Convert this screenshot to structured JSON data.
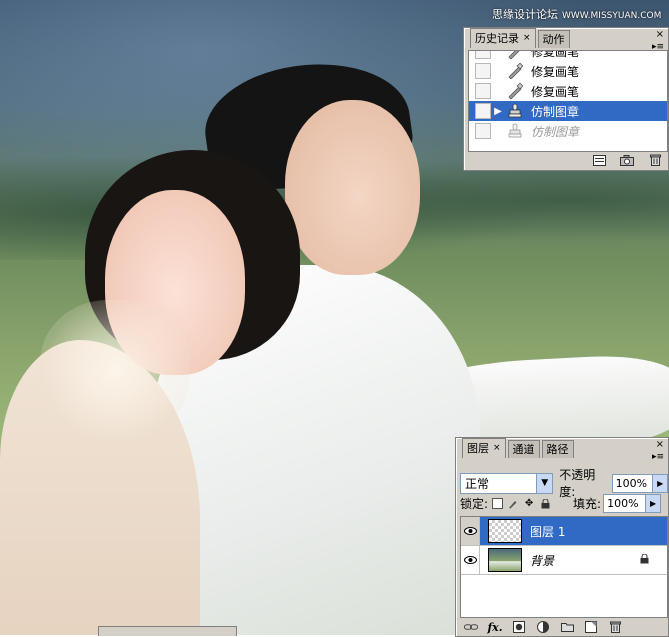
{
  "watermark": {
    "text": "思缘设计论坛",
    "url": "WWW.MISSYUAN.COM"
  },
  "history_panel": {
    "tabs": [
      {
        "label": "历史记录",
        "close": "×"
      },
      {
        "label": "动作"
      }
    ],
    "close_glyph": "×",
    "menu_glyph": "▸≡",
    "items": [
      {
        "label": "修复画笔",
        "icon": "healing-brush-icon"
      },
      {
        "label": "修复画笔",
        "icon": "healing-brush-icon"
      },
      {
        "label": "修复画笔",
        "icon": "healing-brush-icon"
      },
      {
        "label": "仿制图章",
        "icon": "clone-stamp-icon",
        "selected": true,
        "pointer": "▶"
      },
      {
        "label": "仿制图章",
        "icon": "clone-stamp-icon",
        "dimmed": true
      }
    ],
    "footer_icons": [
      "new-document-from-state-icon",
      "snapshot-icon",
      "delete-state-icon"
    ],
    "accent_color": "#316ac5"
  },
  "layers_panel": {
    "tabs": [
      {
        "label": "图层",
        "close": "×"
      },
      {
        "label": "通道"
      },
      {
        "label": "路径"
      }
    ],
    "close_glyph": "×",
    "menu_glyph": "▸≡",
    "blend_mode": "正常",
    "opacity_label": "不透明度:",
    "opacity_value": "100%",
    "lock_label": "锁定:",
    "fill_label": "填充:",
    "fill_value": "100%",
    "layers": [
      {
        "name": "图层 1",
        "selected": true,
        "thumb": "transparent"
      },
      {
        "name": "背景",
        "selected": false,
        "thumb": "photo",
        "locked": true
      }
    ],
    "footer_icons": [
      "link-layers-icon",
      "fx-icon",
      "add-mask-icon",
      "adjustment-layer-icon",
      "new-group-icon",
      "new-layer-icon",
      "delete-layer-icon"
    ],
    "fx_text": "fx."
  }
}
